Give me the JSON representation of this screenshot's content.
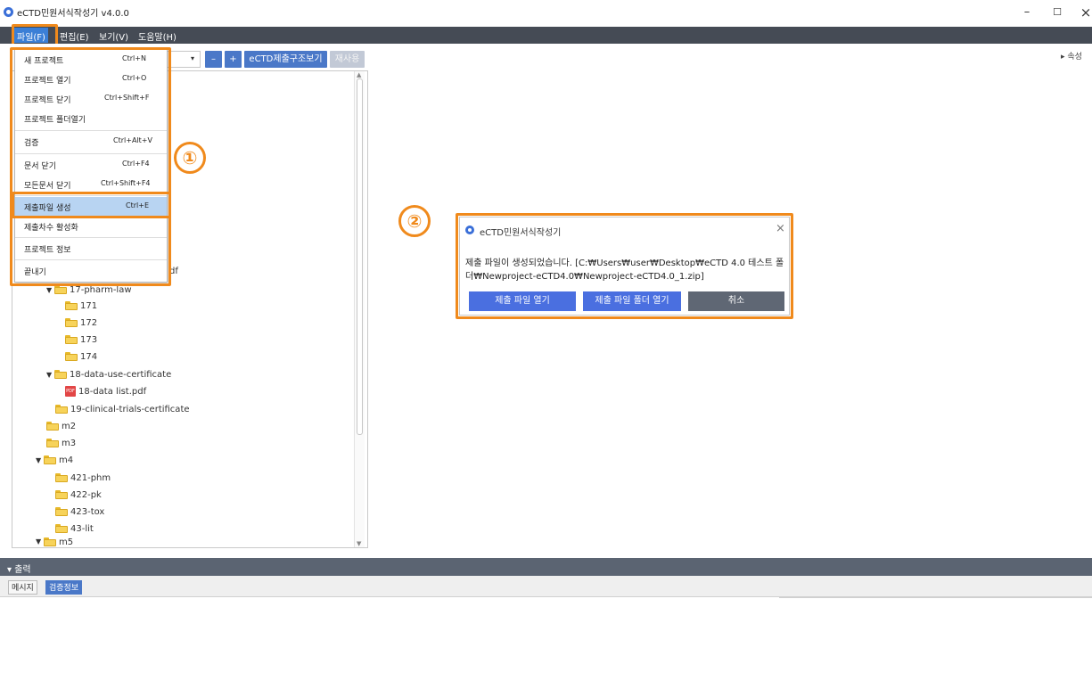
{
  "window": {
    "title": "eCTD민원서식작성기 v4.0.0",
    "minimize_label": "–",
    "maximize_label": "☐",
    "close_label": "×"
  },
  "menubar": {
    "items": [
      {
        "label": "파일(F)"
      },
      {
        "label": "편집(E)"
      },
      {
        "label": "보기(V)"
      },
      {
        "label": "도움말(H)"
      }
    ]
  },
  "toolbar": {
    "combo_arrow": "▾",
    "minus_label": "–",
    "plus_label": "+",
    "structure_view_label": "eCTD제출구조보기",
    "reuse_label": "재사용"
  },
  "properties_tab": {
    "label": "▸ 속성"
  },
  "file_menu": {
    "items": [
      {
        "label": "새 프로젝트",
        "shortcut": "Ctrl+N"
      },
      {
        "label": "프로젝트 열기",
        "shortcut": "Ctrl+O"
      },
      {
        "label": "프로젝트 닫기",
        "shortcut": "Ctrl+Shift+F"
      },
      {
        "label": "프로젝트 폴더열기",
        "shortcut": ""
      },
      {
        "label": "검증",
        "shortcut": "Ctrl+Alt+V"
      },
      {
        "label": "문서 닫기",
        "shortcut": "Ctrl+F4"
      },
      {
        "label": "모든문서 닫기",
        "shortcut": "Ctrl+Shift+F4"
      },
      {
        "label": "제출파일 생성",
        "shortcut": "Ctrl+E",
        "selected": true
      },
      {
        "label": "제출차수 활성화",
        "shortcut": ""
      },
      {
        "label": "프로젝트 정보",
        "shortcut": ""
      },
      {
        "label": "끝내기",
        "shortcut": ""
      }
    ]
  },
  "tree": {
    "partial_text": "df",
    "items": [
      {
        "label": "17-pharm-law",
        "type": "folder",
        "expanded": true
      },
      {
        "label": "171",
        "type": "folder"
      },
      {
        "label": "172",
        "type": "folder"
      },
      {
        "label": "173",
        "type": "folder"
      },
      {
        "label": "174",
        "type": "folder"
      },
      {
        "label": "18-data-use-certificate",
        "type": "folder",
        "expanded": true
      },
      {
        "label": "18-data list.pdf",
        "type": "pdf"
      },
      {
        "label": "19-clinical-trials-certificate",
        "type": "folder"
      },
      {
        "label": "m2",
        "type": "folder"
      },
      {
        "label": "m3",
        "type": "folder"
      },
      {
        "label": "m4",
        "type": "folder",
        "expanded": true
      },
      {
        "label": "421-phm",
        "type": "folder"
      },
      {
        "label": "422-pk",
        "type": "folder"
      },
      {
        "label": "423-tox",
        "type": "folder"
      },
      {
        "label": "43-lit",
        "type": "folder"
      },
      {
        "label": "m5",
        "type": "folder",
        "expanded": true
      }
    ],
    "caret_expanded": "▼",
    "pdf_icon_text": "PDF"
  },
  "annotations": {
    "step1": "①",
    "step2": "②"
  },
  "dialog": {
    "title": "eCTD민원서식작성기",
    "close_label": "×",
    "message": "제출 파일이 생성되었습니다. [C:₩Users₩user₩Desktop₩eCTD 4.0 테스트 폴더₩Newproject-eCTD4.0₩Newproject-eCTD4.0_1.zip]",
    "buttons": {
      "open_file": "제출 파일 열기",
      "open_folder": "제출 파일 폴더 열기",
      "cancel": "취소"
    }
  },
  "output_panel": {
    "title": "▾ 출력",
    "tabs": [
      {
        "label": "메시지",
        "active": false
      },
      {
        "label": "검증정보",
        "active": true
      }
    ]
  },
  "colors": {
    "menubar_bg": "#454b55",
    "accent_blue": "#4a78c8",
    "highlight_orange": "#f08a1c",
    "output_bar_bg": "#5b6472",
    "dialog_cancel_bg": "#5f6774"
  }
}
